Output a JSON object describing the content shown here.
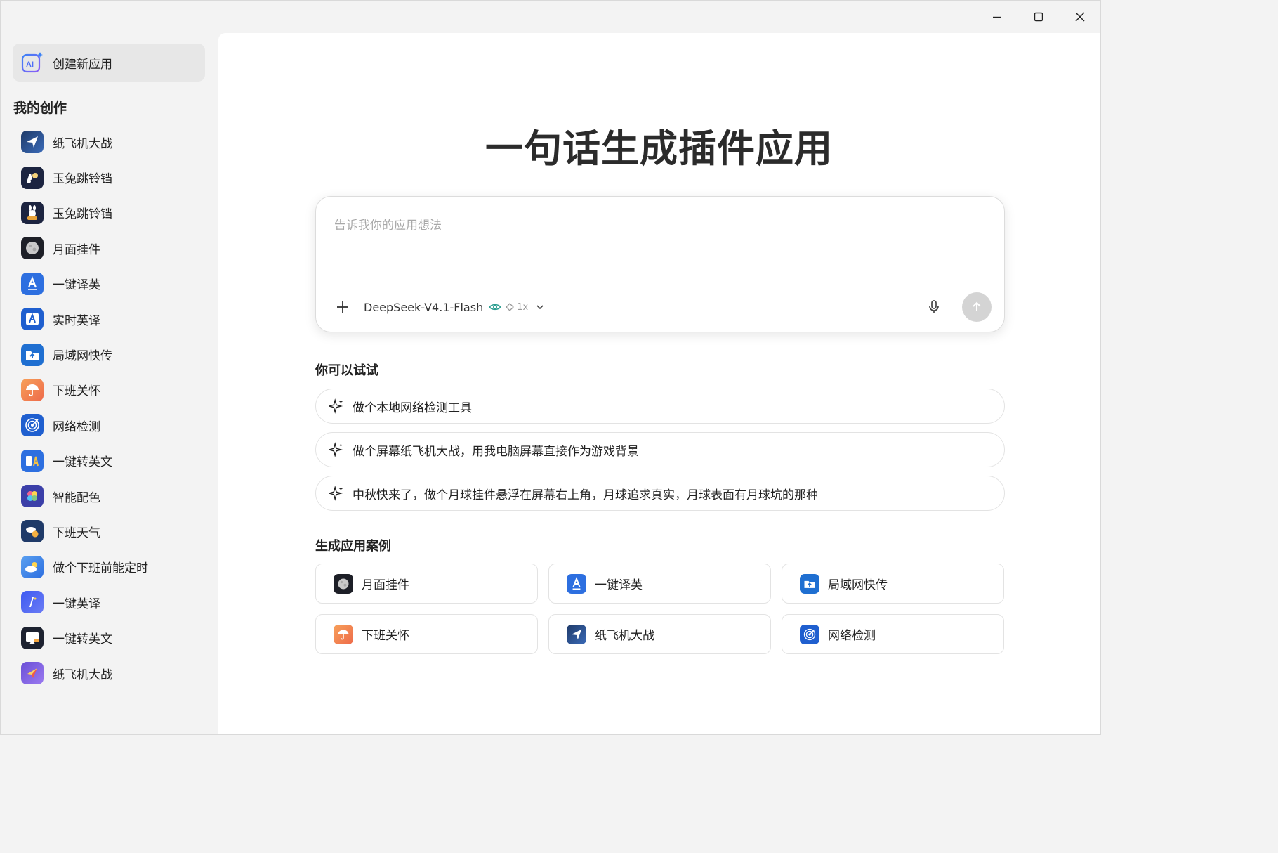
{
  "window": {
    "controls": [
      "minimize",
      "maximize",
      "close"
    ]
  },
  "sidebar": {
    "create_label": "创建新应用",
    "section_title": "我的创作",
    "items": [
      {
        "label": "纸飞机大战",
        "icon": "paper-plane-icon"
      },
      {
        "label": "玉兔跳铃铛",
        "icon": "rabbit-bell-icon"
      },
      {
        "label": "玉兔跳铃铛",
        "icon": "rabbit-icon"
      },
      {
        "label": "月面挂件",
        "icon": "moon-icon"
      },
      {
        "label": "一键译英",
        "icon": "translate-a-icon"
      },
      {
        "label": "实时英译",
        "icon": "translate-box-icon"
      },
      {
        "label": "局域网快传",
        "icon": "folder-upload-icon"
      },
      {
        "label": "下班关怀",
        "icon": "umbrella-icon"
      },
      {
        "label": "网络检测",
        "icon": "radar-icon"
      },
      {
        "label": "一键转英文",
        "icon": "convert-text-icon"
      },
      {
        "label": "智能配色",
        "icon": "palette-icon"
      },
      {
        "label": "下班天气",
        "icon": "weather-icon"
      },
      {
        "label": "做个下班前能定时",
        "icon": "cloud-sun-icon"
      },
      {
        "label": "一键英译",
        "icon": "pen-icon"
      },
      {
        "label": "一键转英文",
        "icon": "screen-icon"
      },
      {
        "label": "纸飞机大战",
        "icon": "rocket-icon"
      }
    ]
  },
  "main": {
    "hero": "一句话生成插件应用",
    "prompt": {
      "placeholder": "告诉我你的应用想法",
      "model": "DeepSeek-V4.1-Flash",
      "multiplier": "1x"
    },
    "try_title": "你可以试试",
    "suggestions": [
      "做个本地网络检测工具",
      "做个屏幕纸飞机大战，用我电脑屏幕直接作为游戏背景",
      "中秋快来了，做个月球挂件悬浮在屏幕右上角，月球追求真实，月球表面有月球坑的那种"
    ],
    "cases_title": "生成应用案例",
    "cases": [
      {
        "label": "月面挂件",
        "icon": "moon-icon"
      },
      {
        "label": "一键译英",
        "icon": "translate-a-icon"
      },
      {
        "label": "局域网快传",
        "icon": "folder-upload-icon"
      },
      {
        "label": "下班关怀",
        "icon": "umbrella-icon"
      },
      {
        "label": "纸飞机大战",
        "icon": "paper-plane-icon"
      },
      {
        "label": "网络检测",
        "icon": "radar-icon"
      }
    ]
  },
  "colors": {
    "accent_blue": "#2d6fe0",
    "send_disabled": "#d4d4d4",
    "eye_green": "#2a9d8f"
  }
}
